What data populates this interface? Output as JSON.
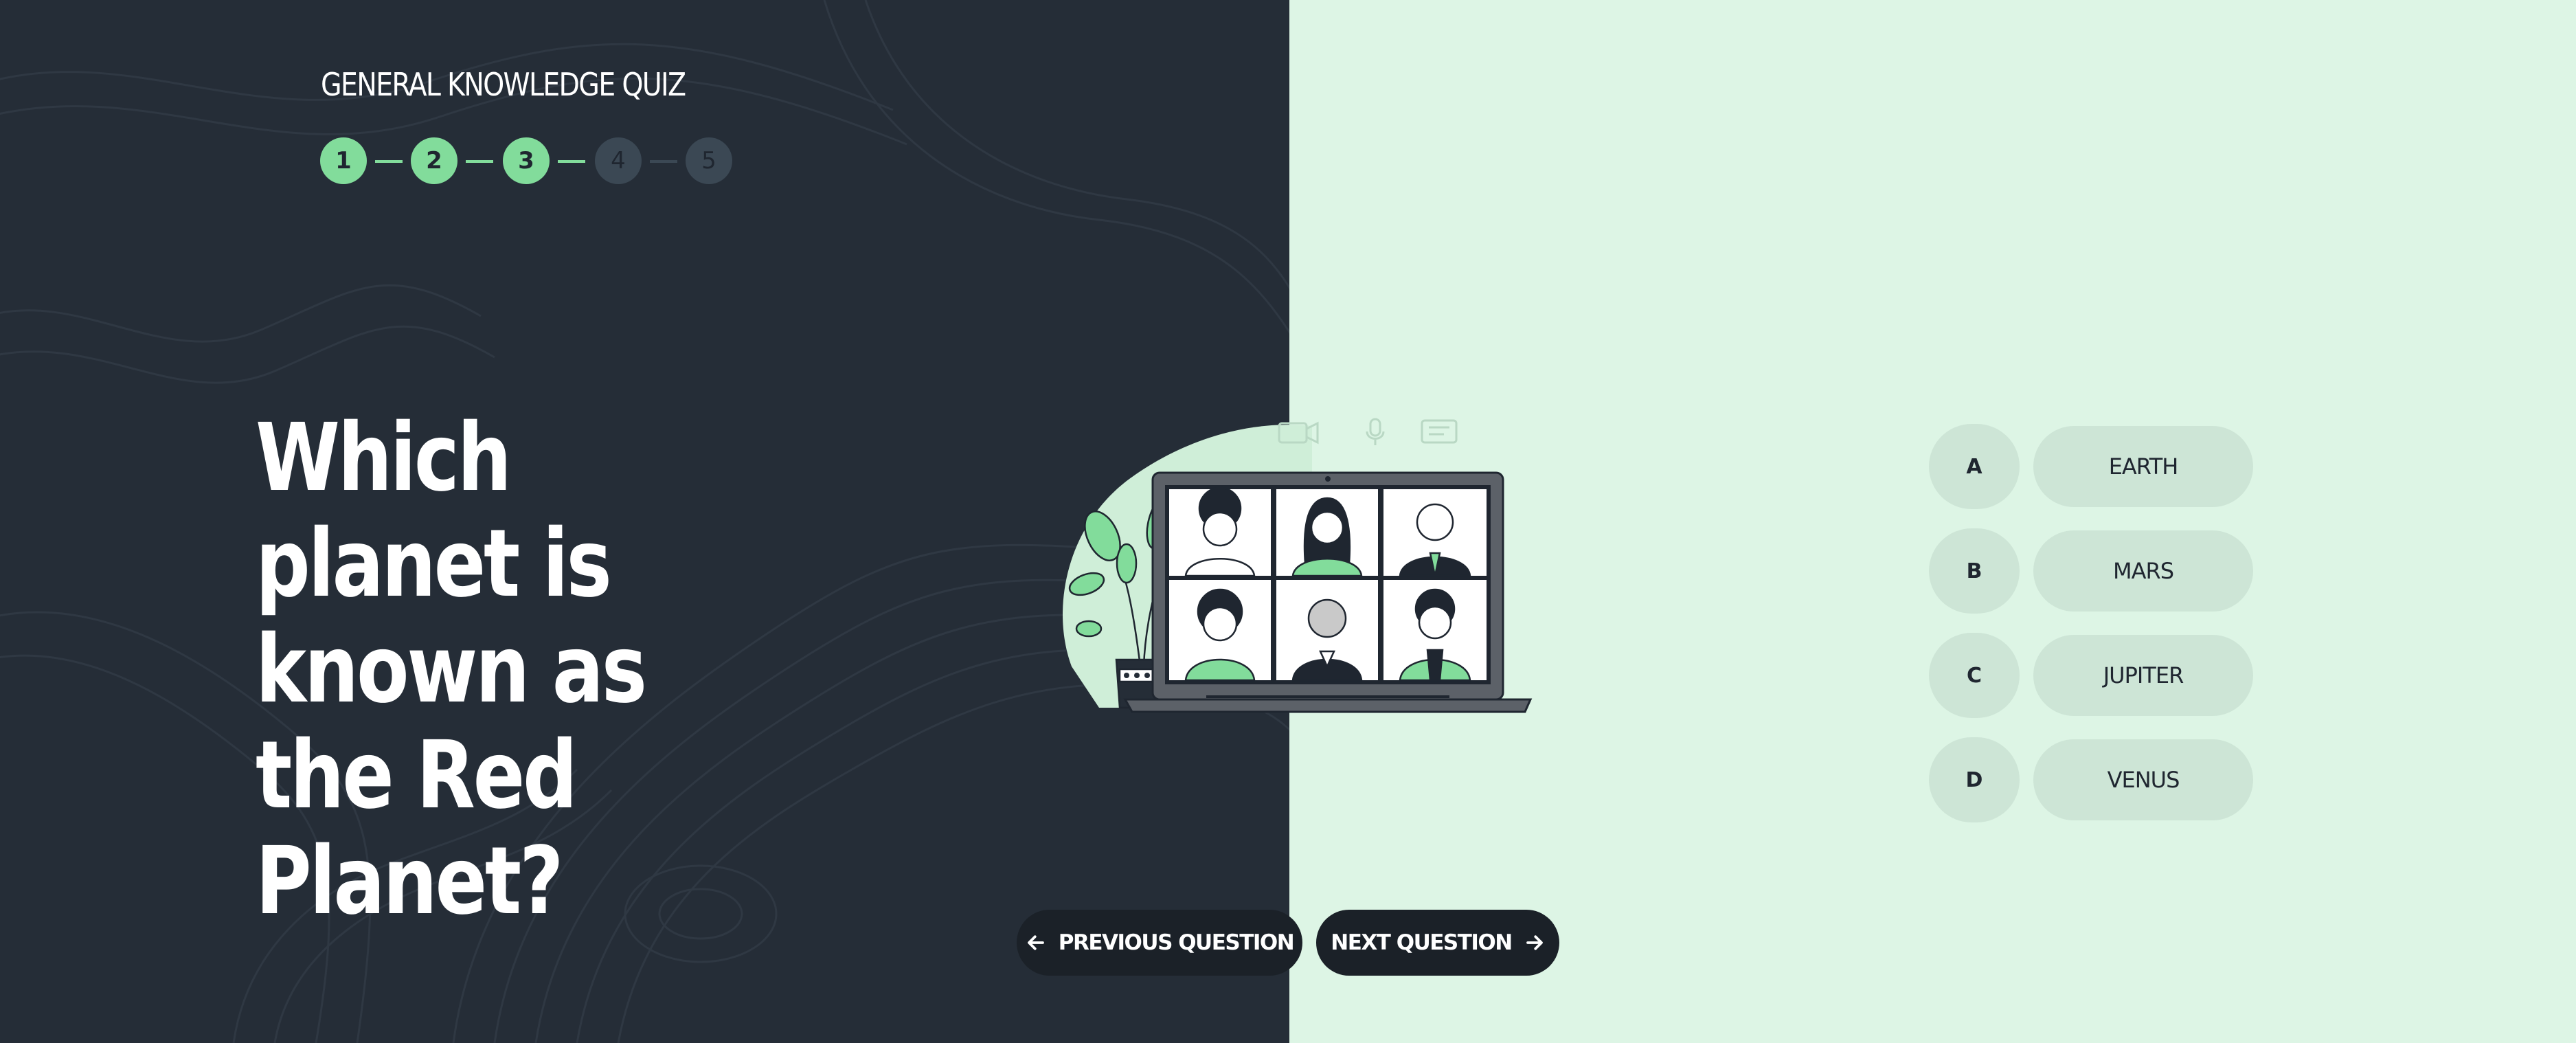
{
  "quiz": {
    "title": "GENERAL KNOWLEDGE QUIZ",
    "steps": [
      {
        "label": "1",
        "state": "done"
      },
      {
        "label": "2",
        "state": "done"
      },
      {
        "label": "3",
        "state": "done"
      },
      {
        "label": "4",
        "state": "todo"
      },
      {
        "label": "5",
        "state": "todo"
      }
    ],
    "question": "Which planet is known as the Red Planet?",
    "options": [
      {
        "letter": "A",
        "text": "EARTH"
      },
      {
        "letter": "B",
        "text": "MARS"
      },
      {
        "letter": "C",
        "text": "JUPITER"
      },
      {
        "letter": "D",
        "text": "VENUS"
      }
    ]
  },
  "navigation": {
    "prev_label": "PREVIOUS QUESTION",
    "next_label": "NEXT QUESTION"
  },
  "colors": {
    "dark_panel": "#252d37",
    "light_panel": "#ddf5e5",
    "accent_green": "#82dc9b",
    "option_bg": "#cde5d6",
    "button_bg": "#1b2128"
  },
  "icons": {
    "prev": "arrow-left-icon",
    "next": "arrow-right-icon"
  }
}
